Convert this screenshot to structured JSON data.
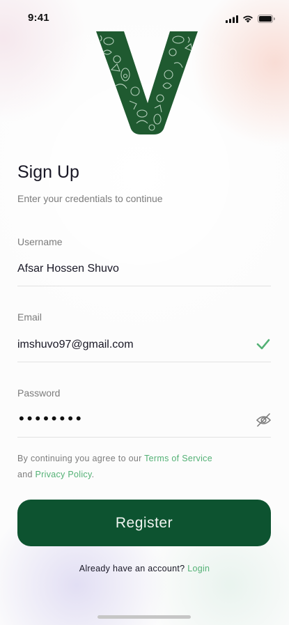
{
  "status_bar": {
    "time": "9:41",
    "icons": [
      "signal-icon",
      "wifi-icon",
      "battery-icon"
    ]
  },
  "logo": {
    "letter": "V",
    "color": "#1f5a30"
  },
  "header": {
    "title": "Sign Up",
    "subtitle": "Enter your credentials to continue"
  },
  "form": {
    "username": {
      "label": "Username",
      "value": "Afsar Hossen Shuvo"
    },
    "email": {
      "label": "Email",
      "value": "imshuvo97@gmail.com",
      "valid": true
    },
    "password": {
      "label": "Password",
      "masked_value": "••••••••"
    }
  },
  "terms": {
    "prefix": "By continuing you agree to our ",
    "terms_link": "Terms of Service",
    "middle": "and ",
    "privacy_link": "Privacy Policy",
    "suffix": "."
  },
  "register_button": {
    "label": "Register"
  },
  "footer": {
    "prompt": "Already have an account? ",
    "login_link": "Login"
  },
  "colors": {
    "primary": "#0d5330",
    "accent": "#53b175",
    "muted": "#7c7c7c",
    "text": "#181725"
  }
}
